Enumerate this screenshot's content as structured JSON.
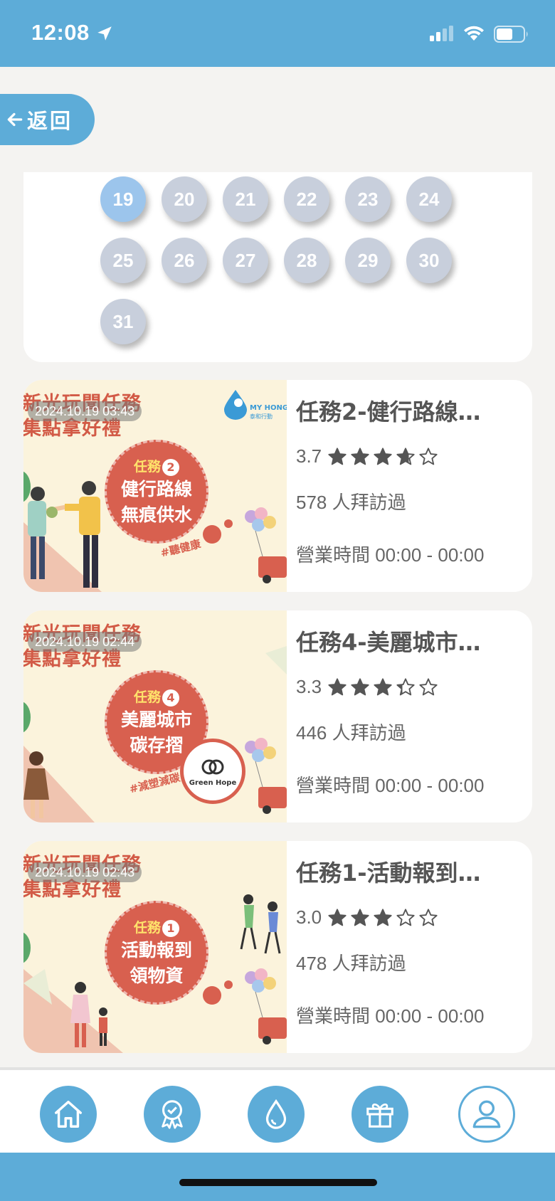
{
  "status_bar": {
    "time": "12:08"
  },
  "back_button": {
    "label": "返回"
  },
  "calendar": {
    "days": [
      "19",
      "20",
      "21",
      "22",
      "23",
      "24",
      "25",
      "26",
      "27",
      "28",
      "29",
      "30",
      "31"
    ],
    "selected": "19"
  },
  "tasks": [
    {
      "title": "任務2-健行路線…",
      "timestamp": "2024.10.19 03:43",
      "poster_heading": [
        "新光玩聞任務",
        "集點拿好禮"
      ],
      "poster_badge": "任務",
      "poster_number": "2",
      "poster_lines": [
        "健行路線",
        "無痕供水"
      ],
      "poster_hashtag": "#聽健康",
      "poster_brand": "MY HONG TE",
      "poster_brand_sub": "泰和行動",
      "rating": "3.7",
      "stars": 3.7,
      "visits": "578 人拜訪過",
      "hours": "營業時間 00:00 - 00:00"
    },
    {
      "title": "任務4-美麗城市…",
      "timestamp": "2024.10.19 02:44",
      "poster_heading": [
        "新光玩聞任務",
        "集點拿好禮"
      ],
      "poster_badge": "任務",
      "poster_number": "4",
      "poster_lines": [
        "美麗城市",
        "碳存摺"
      ],
      "poster_hashtag": "#減塑減碳",
      "poster_partner": "Green Hope",
      "rating": "3.3",
      "stars": 3.3,
      "visits": "446 人拜訪過",
      "hours": "營業時間 00:00 - 00:00"
    },
    {
      "title": "任務1-活動報到…",
      "timestamp": "2024.10.19 02:43",
      "poster_heading": [
        "新光玩聞任務",
        "集點拿好禮"
      ],
      "poster_badge": "任務",
      "poster_number": "1",
      "poster_lines": [
        "活動報到",
        "領物資"
      ],
      "rating": "3.0",
      "stars": 3.0,
      "visits": "478 人拜訪過",
      "hours": "營業時間 00:00 - 00:00"
    }
  ],
  "tab_bar": {
    "tabs": [
      {
        "icon": "home-icon"
      },
      {
        "icon": "badge-icon"
      },
      {
        "icon": "water-drop-icon"
      },
      {
        "icon": "gift-icon"
      },
      {
        "icon": "profile-icon",
        "active": true
      }
    ]
  },
  "colors": {
    "primary": "#5dacd8",
    "day_default": "#c8cfdc",
    "day_selected": "#9cc5ec",
    "poster_red": "#d8604f"
  }
}
